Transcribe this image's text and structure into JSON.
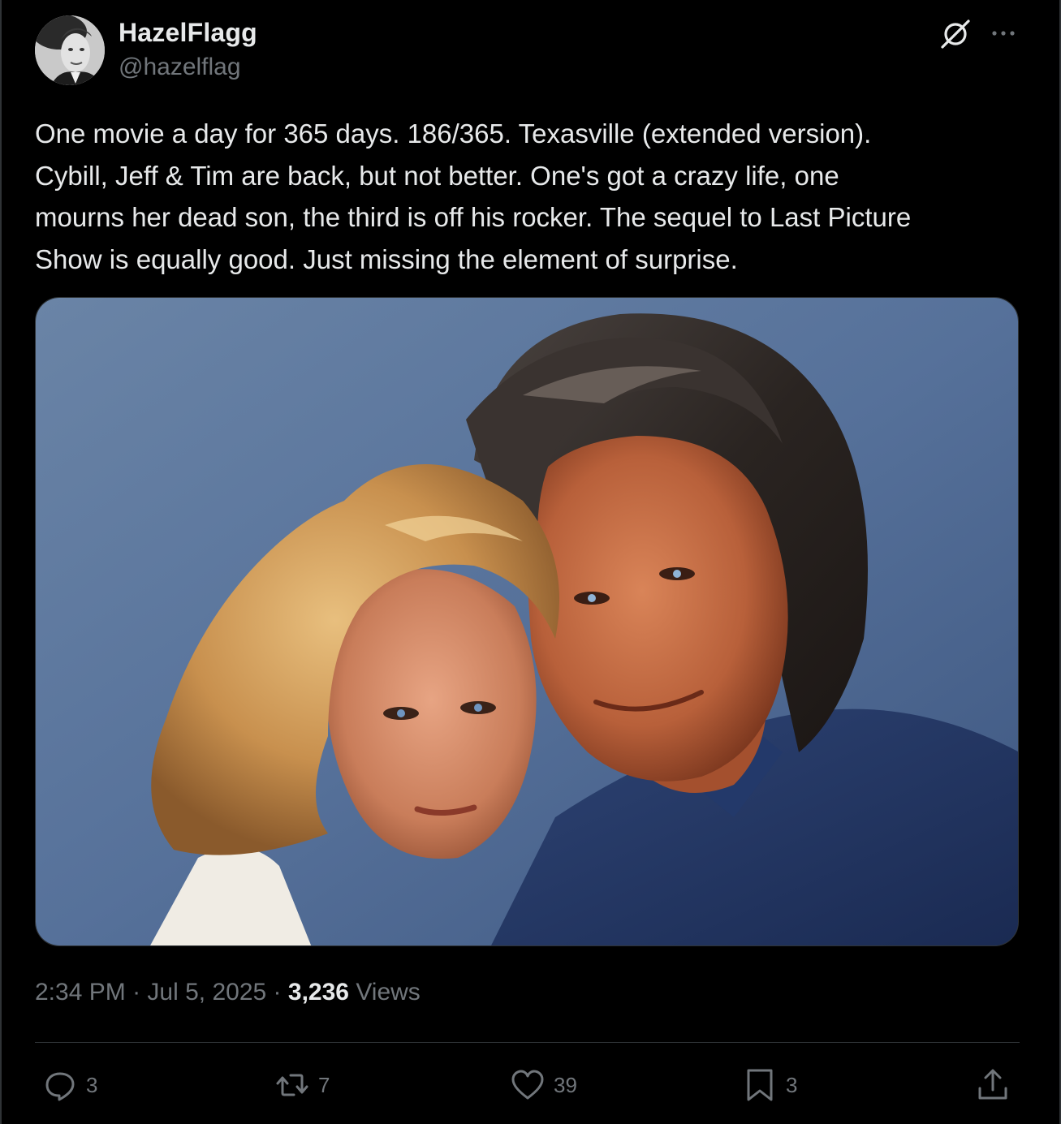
{
  "author": {
    "display_name": "HazelFlagg",
    "handle": "@hazelflag"
  },
  "header_icons": {
    "grok": "grok-icon",
    "more": "more-icon"
  },
  "tweet": {
    "text": "One movie a day for 365 days. 186/365. Texasville (extended version).\nCybill, Jeff & Tim are back, but not better. One's got a crazy life, one\nmourns her dead son, the third is off his rocker. The sequel to Last Picture\nShow is equally good. Just missing the element of surprise.",
    "media": {
      "kind": "photo"
    }
  },
  "meta": {
    "time": "2:34 PM",
    "sep1": "·",
    "date": "Jul 5, 2025",
    "sep2": "·",
    "views_count": "3,236",
    "views_label": "Views"
  },
  "actions": {
    "reply": {
      "icon": "reply-icon",
      "count": "3"
    },
    "repost": {
      "icon": "repost-icon",
      "count": "7"
    },
    "like": {
      "icon": "heart-icon",
      "count": "39"
    },
    "bookmark": {
      "icon": "bookmark-icon",
      "count": "3"
    },
    "share": {
      "icon": "share-icon"
    }
  },
  "colors": {
    "background": "#000000",
    "text_primary": "#e7e9ea",
    "text_secondary": "#71767b",
    "border": "#2f3336"
  }
}
